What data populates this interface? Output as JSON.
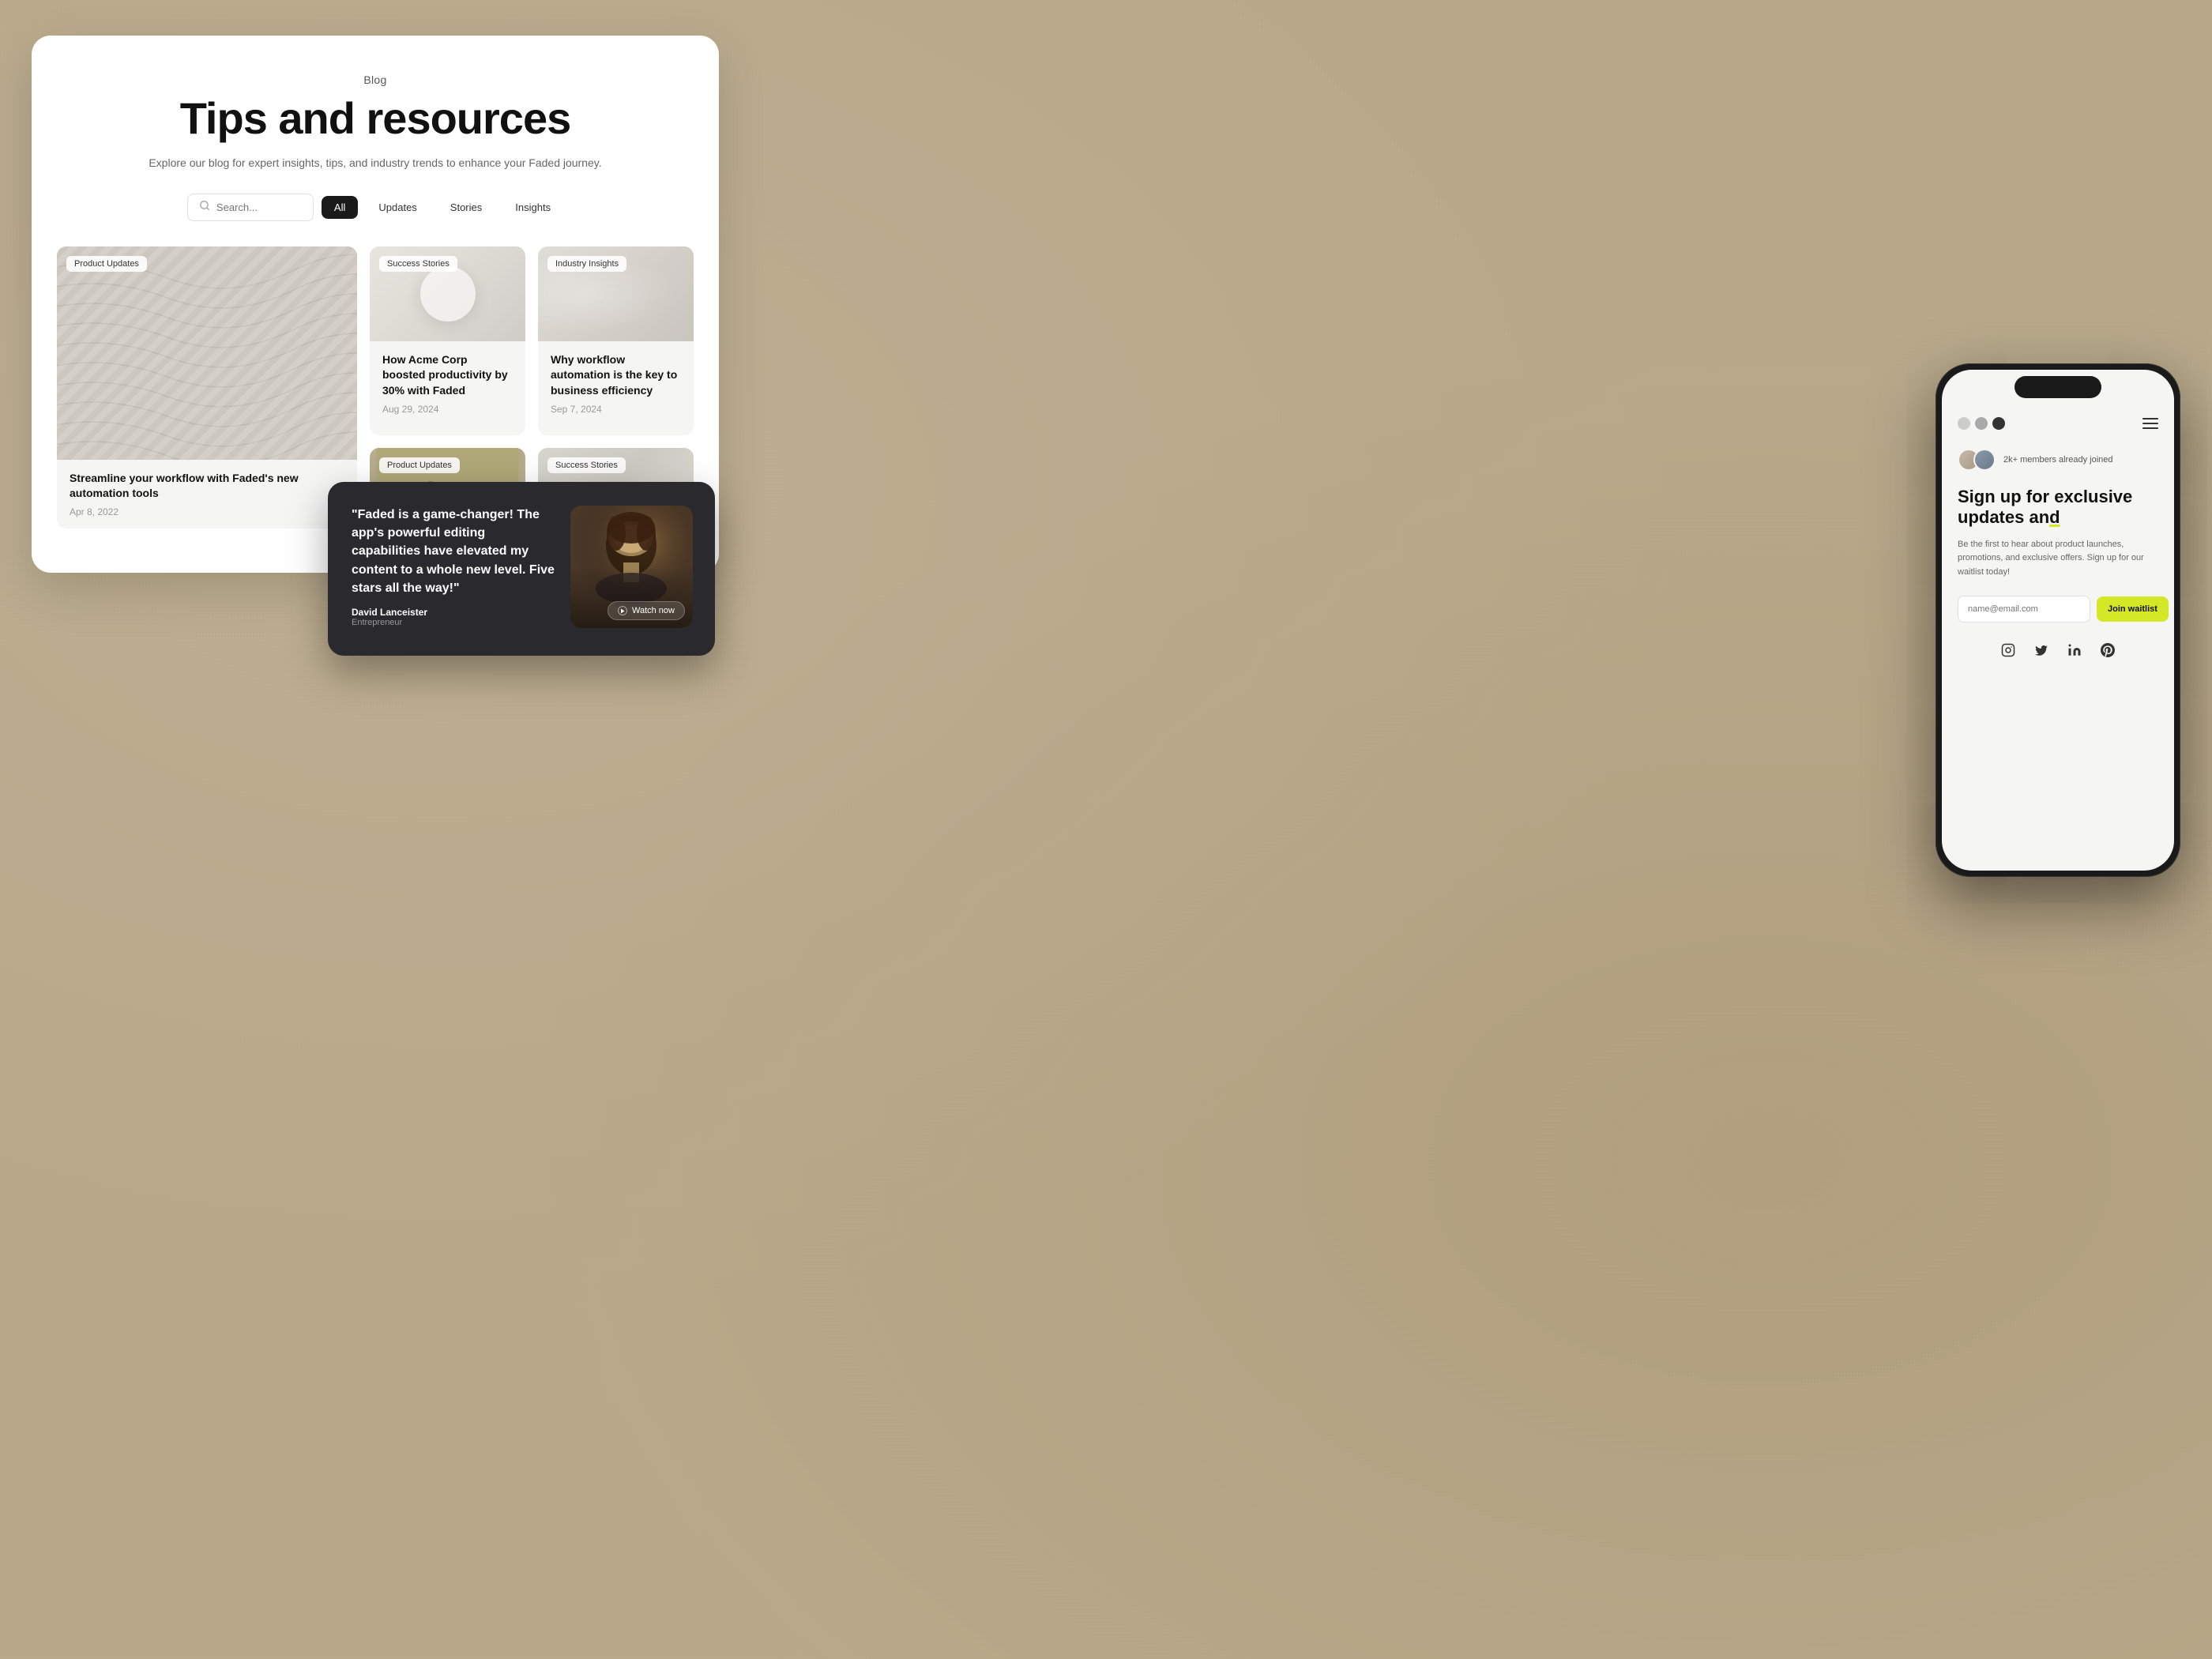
{
  "background": {
    "color": "#b8a98a"
  },
  "blog_card": {
    "label": "Blog",
    "title": "Tips and resources",
    "subtitle": "Explore our blog for expert insights, tips, and industry trends to enhance your Faded journey.",
    "search": {
      "placeholder": "Search..."
    },
    "filters": [
      {
        "id": "all",
        "label": "All",
        "active": true
      },
      {
        "id": "updates",
        "label": "Updates",
        "active": false
      },
      {
        "id": "stories",
        "label": "Stories",
        "active": false
      },
      {
        "id": "insights",
        "label": "Insights",
        "active": false
      }
    ],
    "posts": [
      {
        "id": "post-1",
        "tag": "Product Updates",
        "title": "Streamline your workflow with Faded's new automation tools",
        "date": "Apr 8, 2022",
        "featured": true,
        "img_type": "wavy"
      },
      {
        "id": "post-2",
        "tag": "Success Stories",
        "title": "How Acme Corp boosted productivity by 30% with Faded",
        "date": "Aug 29, 2024",
        "featured": false,
        "img_type": "round"
      },
      {
        "id": "post-3",
        "tag": "Industry Insights",
        "title": "Why workflow automation is the key to business efficiency",
        "date": "Sep 7, 2024",
        "featured": false,
        "img_type": "dust"
      },
      {
        "id": "post-4",
        "tag": "Product Updates",
        "title": "",
        "date": "",
        "featured": false,
        "img_type": "plant"
      },
      {
        "id": "post-5",
        "tag": "Success Stories",
        "title": "",
        "date": "",
        "featured": false,
        "img_type": "bust"
      }
    ]
  },
  "testimonial": {
    "quote": "\"Faded is a game-changer! The app's powerful editing capabilities have elevated my content to a whole new level. Five stars all the way!\"",
    "author_name": "David Lanceister",
    "author_title": "Entrepreneur",
    "video_label": "Watch now"
  },
  "phone": {
    "nav": {
      "dots": [
        "light",
        "mid",
        "dark"
      ]
    },
    "members_text": "2k+ members already joined",
    "hero_title": "Sign up for exclusive updates an",
    "hero_title_highlight": "d",
    "hero_desc": "Be the first to hear about product launches, promotions, and exclusive offers. Sign up for our waitlist today!",
    "email_placeholder": "name@email.com",
    "cta_label": "Join waitlist",
    "social_icons": [
      "instagram",
      "twitter",
      "linkedin",
      "pinterest"
    ]
  }
}
